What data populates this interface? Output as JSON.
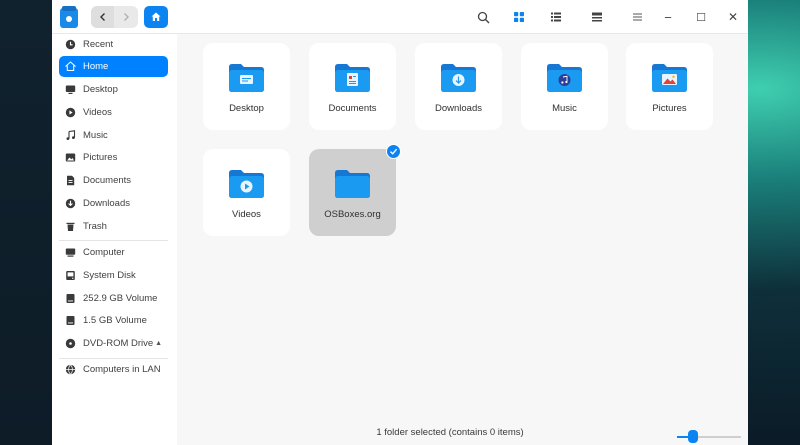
{
  "colors": {
    "accent": "#0081ff",
    "folder_blue": "#1a9af0",
    "window_bg": "#f7f7f7",
    "selected_tile": "#cfcfcf"
  },
  "toolbar": {
    "back_icon": "chevron-left-icon",
    "forward_icon": "chevron-right-icon",
    "home_icon": "home-icon",
    "search_icon": "search-icon",
    "view_icons": [
      "icon-view-icon",
      "list-view-icon",
      "details-view-icon"
    ],
    "menu_icon": "hamburger-menu-icon",
    "minimize_glyph": "−",
    "maximize_glyph": "☐",
    "close_glyph": "✕"
  },
  "sidebar": {
    "items": [
      {
        "label": "Recent",
        "icon": "clock-icon"
      },
      {
        "label": "Home",
        "icon": "home-icon",
        "active": true
      },
      {
        "label": "Desktop",
        "icon": "desktop-icon"
      },
      {
        "label": "Videos",
        "icon": "video-icon"
      },
      {
        "label": "Music",
        "icon": "music-icon"
      },
      {
        "label": "Pictures",
        "icon": "picture-icon"
      },
      {
        "label": "Documents",
        "icon": "document-icon"
      },
      {
        "label": "Downloads",
        "icon": "download-icon"
      },
      {
        "label": "Trash",
        "icon": "trash-icon"
      },
      {
        "label": "Computer",
        "icon": "computer-icon"
      },
      {
        "label": "System Disk",
        "icon": "disk-icon"
      },
      {
        "label": "252.9 GB Volume",
        "icon": "drive-icon"
      },
      {
        "label": "1.5 GB Volume",
        "icon": "drive-icon"
      },
      {
        "label": "DVD-ROM Drive",
        "icon": "dvd-icon",
        "eject": "▲"
      },
      {
        "label": "Computers in LAN",
        "icon": "network-icon"
      }
    ]
  },
  "files": [
    {
      "name": "Desktop",
      "icon": "desktop-folder-icon"
    },
    {
      "name": "Documents",
      "icon": "documents-folder-icon"
    },
    {
      "name": "Downloads",
      "icon": "downloads-folder-icon"
    },
    {
      "name": "Music",
      "icon": "music-folder-icon"
    },
    {
      "name": "Pictures",
      "icon": "pictures-folder-icon"
    },
    {
      "name": "Videos",
      "icon": "videos-folder-icon"
    },
    {
      "name": "OSBoxes.org",
      "icon": "folder-icon",
      "selected": true
    }
  ],
  "status": {
    "text": "1 folder selected (contains 0 items)"
  },
  "zoom": {
    "level": 0.25
  }
}
